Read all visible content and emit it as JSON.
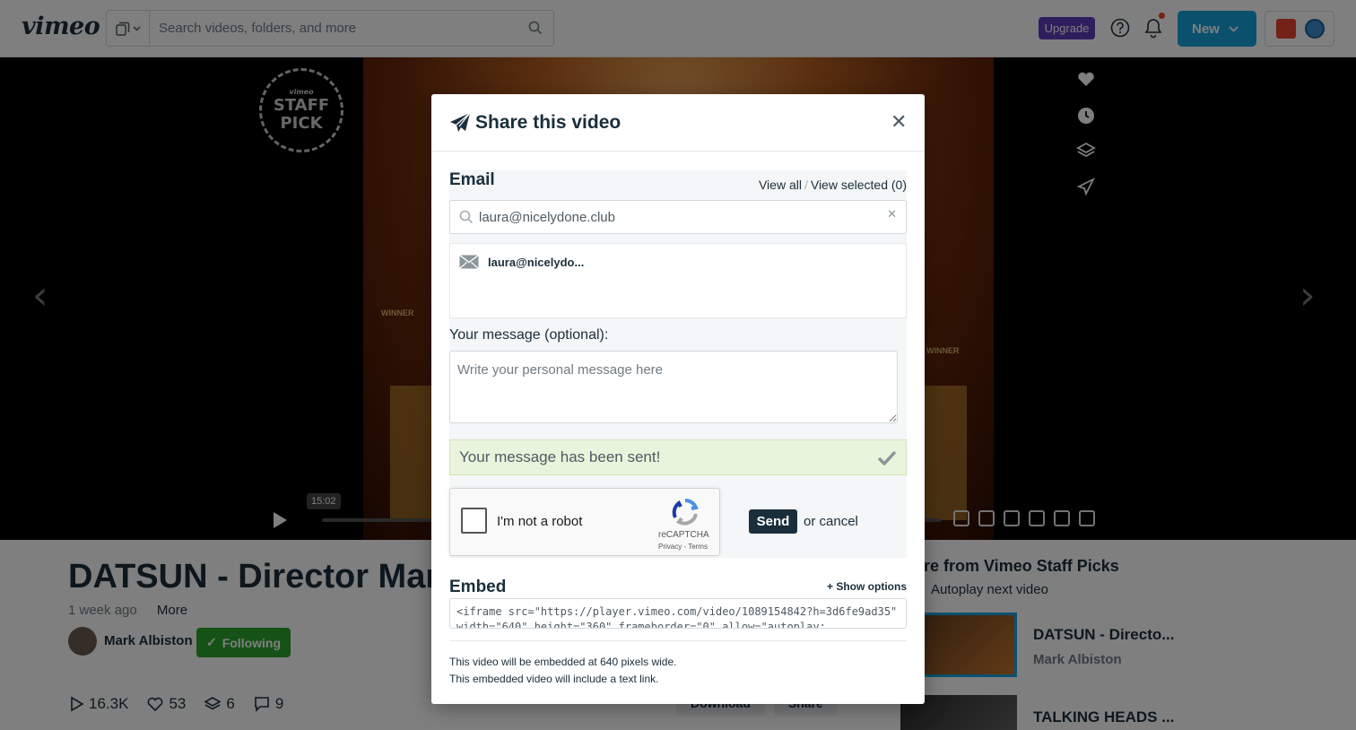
{
  "topbar": {
    "logo": "vimeo",
    "search_placeholder": "Search videos, folders, and more",
    "upgrade_label": "Upgrade",
    "new_label": "New"
  },
  "player": {
    "badge_top": "vimeo",
    "badge_line1": "STAFF",
    "badge_line2": "PICK",
    "laurel_left": "WINNER",
    "laurel_right": "WINNER",
    "time_tooltip": "15:02"
  },
  "video": {
    "title": "DATSUN - Director Mark Albiston",
    "posted": "1 week ago",
    "more_label": "More",
    "author": "Mark Albiston",
    "follow_label": "Following",
    "stats": {
      "plays": "16.3K",
      "likes": "53",
      "collections": "6",
      "comments": "9"
    },
    "download_label": "Download",
    "share_label": "Share"
  },
  "upnext": {
    "heading": "More from Vimeo Staff Picks",
    "autoplay_label": "Autoplay next video",
    "items": [
      {
        "title": "DATSUN - Directo...",
        "author": "Mark Albiston"
      },
      {
        "title": "TALKING HEADS ...",
        "author": ""
      }
    ]
  },
  "modal": {
    "title": "Share this video",
    "email_label": "Email",
    "view_all": "View all",
    "link_separator": "/",
    "view_selected": "View selected (0)",
    "email_value": "laura@nicelydone.club",
    "recipient": "laura@nicelydo...",
    "message_label": "Your message (optional):",
    "message_placeholder": "Write your personal message here",
    "success_text": "Your message has been sent!",
    "captcha_label": "I'm not a robot",
    "captcha_brand": "reCAPTCHA",
    "captcha_terms": "Privacy - Terms",
    "send_label": "Send",
    "or_cancel": "or cancel",
    "embed_label": "Embed",
    "show_options": "+ Show options",
    "embed_code": "<iframe src=\"https://player.vimeo.com/video/1089154842?h=3d6fe9ad35\"\nwidth=\"640\" height=\"360\" frameborder=\"0\" allow=\"autoplay;",
    "embed_note_1": "This video will be embedded at 640 pixels wide.",
    "embed_note_2": "This embedded video will include a text link."
  }
}
